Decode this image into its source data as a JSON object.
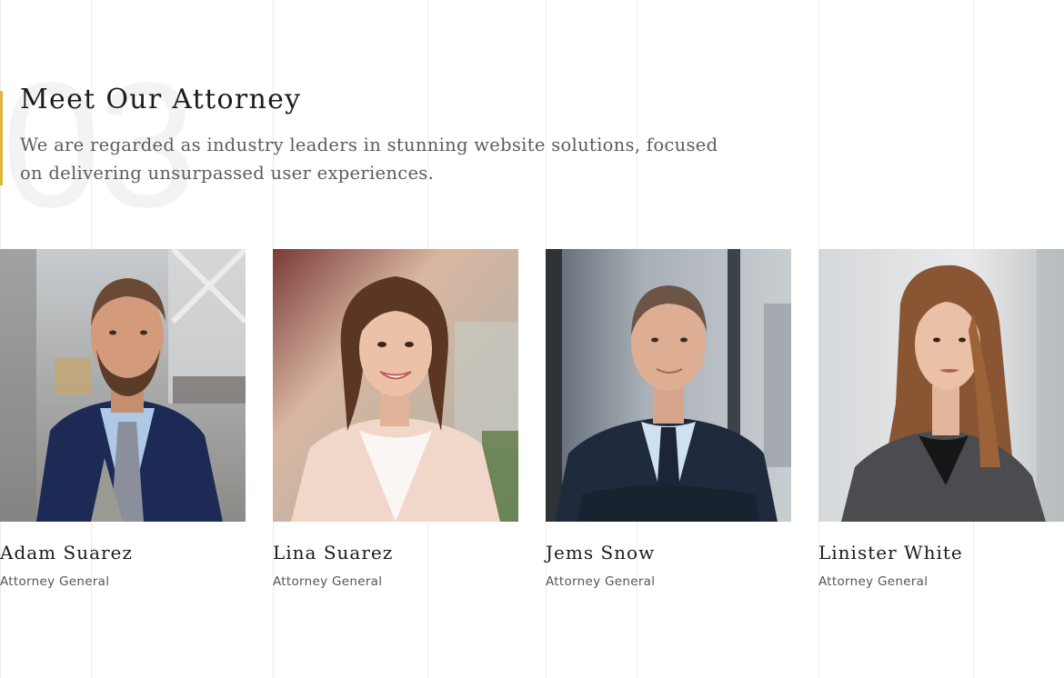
{
  "section": {
    "number": "03",
    "title": "Meet Our Attorney",
    "description": "We are regarded as industry leaders in stunning website solutions, focused on delivering unsurpassed user experiences."
  },
  "colors": {
    "accent": "#e0b43a",
    "heading": "#1b1b1b",
    "body_text": "#5c5c5c",
    "number_ghost": "#f3f3f3"
  },
  "attorneys": [
    {
      "name": "Adam Suarez",
      "role": "Attorney General",
      "photo": "man-beard-blazer-portrait"
    },
    {
      "name": "Lina Suarez",
      "role": "Attorney General",
      "photo": "woman-smiling-portrait"
    },
    {
      "name": "Jems Snow",
      "role": "Attorney General",
      "photo": "man-suit-portrait"
    },
    {
      "name": "Linister White",
      "role": "Attorney General",
      "photo": "woman-long-hair-portrait"
    }
  ]
}
